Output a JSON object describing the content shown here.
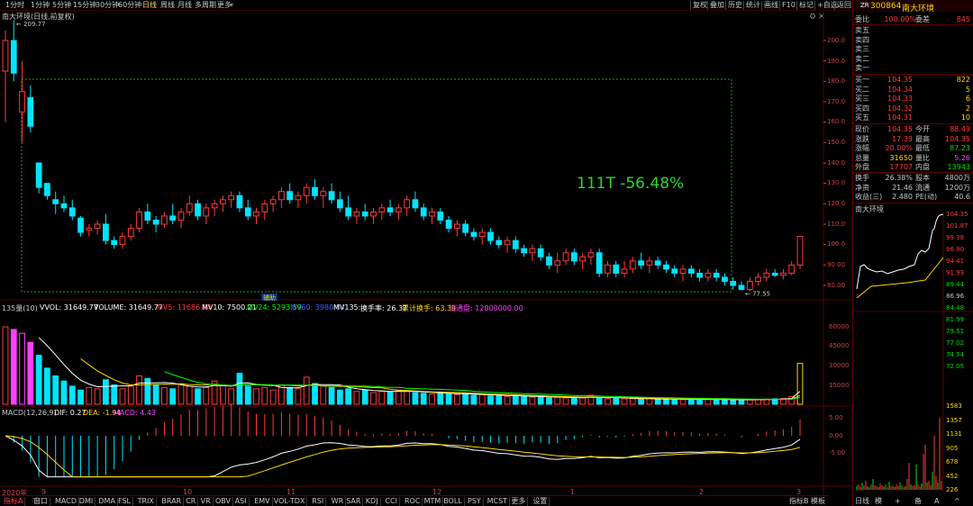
{
  "toolbar": {
    "periods": [
      "1分时",
      "1分钟",
      "5分钟",
      "15分钟",
      "30分钟",
      "60分钟",
      "日线",
      "周线",
      "月线",
      "多周期",
      "更多"
    ],
    "active_period": "日线",
    "tools": [
      "复权",
      "叠加",
      "历史",
      "统计",
      "画线",
      "F10",
      "标记",
      "+自选",
      "返回"
    ]
  },
  "chart": {
    "stock_label": "南大环境(日线,前复权)",
    "high_label": "209.77",
    "low_label": "77.55",
    "annotation": "111T -56.48%",
    "marker_label": "辅助",
    "candles": [
      [
        185,
        205,
        160,
        200
      ],
      [
        200,
        210,
        180,
        184
      ],
      [
        165,
        190,
        150,
        175
      ],
      [
        172,
        178,
        155,
        158
      ],
      [
        140,
        140,
        125,
        128
      ],
      [
        130,
        130,
        122,
        124
      ],
      [
        122,
        126,
        115,
        120
      ],
      [
        120,
        124,
        116,
        118
      ],
      [
        118,
        122,
        112,
        114
      ],
      [
        113,
        114,
        104,
        106
      ],
      [
        107,
        110,
        104,
        108
      ],
      [
        108,
        112,
        105,
        110
      ],
      [
        110,
        115,
        100,
        102
      ],
      [
        102,
        104,
        98,
        100
      ],
      [
        100,
        106,
        98,
        104
      ],
      [
        104,
        110,
        102,
        108
      ],
      [
        108,
        118,
        106,
        116
      ],
      [
        116,
        120,
        110,
        112
      ],
      [
        112,
        114,
        106,
        110
      ],
      [
        110,
        116,
        108,
        114
      ],
      [
        114,
        120,
        110,
        112
      ],
      [
        112,
        118,
        108,
        116
      ],
      [
        116,
        124,
        114,
        120
      ],
      [
        120,
        122,
        112,
        114
      ],
      [
        114,
        120,
        110,
        118
      ],
      [
        118,
        122,
        114,
        120
      ],
      [
        120,
        124,
        116,
        122
      ],
      [
        122,
        126,
        118,
        124
      ],
      [
        124,
        126,
        116,
        118
      ],
      [
        118,
        122,
        112,
        114
      ],
      [
        114,
        118,
        110,
        116
      ],
      [
        116,
        122,
        112,
        120
      ],
      [
        120,
        124,
        116,
        122
      ],
      [
        122,
        128,
        118,
        126
      ],
      [
        126,
        130,
        120,
        122
      ],
      [
        122,
        126,
        118,
        124
      ],
      [
        124,
        130,
        120,
        128
      ],
      [
        128,
        132,
        122,
        124
      ],
      [
        124,
        128,
        118,
        126
      ],
      [
        126,
        130,
        120,
        122
      ],
      [
        122,
        126,
        116,
        118
      ],
      [
        118,
        124,
        112,
        114
      ],
      [
        114,
        118,
        110,
        116
      ],
      [
        116,
        120,
        112,
        114
      ],
      [
        114,
        118,
        110,
        116
      ],
      [
        116,
        120,
        112,
        118
      ],
      [
        118,
        122,
        114,
        116
      ],
      [
        116,
        120,
        112,
        118
      ],
      [
        118,
        124,
        114,
        122
      ],
      [
        122,
        126,
        116,
        118
      ],
      [
        118,
        120,
        112,
        114
      ],
      [
        114,
        118,
        110,
        116
      ],
      [
        116,
        118,
        110,
        112
      ],
      [
        112,
        114,
        106,
        108
      ],
      [
        108,
        112,
        104,
        110
      ],
      [
        110,
        112,
        104,
        106
      ],
      [
        106,
        108,
        102,
        104
      ],
      [
        104,
        108,
        100,
        106
      ],
      [
        106,
        108,
        100,
        102
      ],
      [
        102,
        104,
        98,
        100
      ],
      [
        100,
        104,
        96,
        102
      ],
      [
        102,
        104,
        96,
        98
      ],
      [
        98,
        100,
        94,
        96
      ],
      [
        96,
        100,
        92,
        98
      ],
      [
        98,
        100,
        92,
        94
      ],
      [
        94,
        96,
        88,
        90
      ],
      [
        90,
        96,
        86,
        92
      ],
      [
        92,
        98,
        90,
        96
      ],
      [
        96,
        98,
        90,
        92
      ],
      [
        92,
        96,
        88,
        94
      ],
      [
        94,
        98,
        90,
        96
      ],
      [
        96,
        98,
        84,
        86
      ],
      [
        86,
        92,
        84,
        90
      ],
      [
        90,
        92,
        84,
        86
      ],
      [
        86,
        92,
        84,
        88
      ],
      [
        88,
        94,
        86,
        92
      ],
      [
        92,
        96,
        88,
        90
      ],
      [
        90,
        94,
        86,
        92
      ],
      [
        92,
        94,
        88,
        90
      ],
      [
        90,
        92,
        86,
        88
      ],
      [
        88,
        90,
        84,
        86
      ],
      [
        86,
        90,
        82,
        88
      ],
      [
        88,
        90,
        84,
        86
      ],
      [
        86,
        88,
        82,
        84
      ],
      [
        84,
        88,
        82,
        86
      ],
      [
        86,
        88,
        82,
        84
      ],
      [
        84,
        86,
        80,
        82
      ],
      [
        82,
        84,
        78,
        80
      ],
      [
        80,
        82,
        77.55,
        78
      ],
      [
        78,
        84,
        77,
        82
      ],
      [
        82,
        86,
        80,
        84
      ],
      [
        84,
        88,
        82,
        86
      ],
      [
        86,
        88,
        84,
        85
      ],
      [
        85,
        88,
        83,
        86
      ],
      [
        86,
        92,
        85,
        90
      ],
      [
        90,
        104.35,
        88,
        104
      ]
    ],
    "y_ticks": [
      "200.0",
      "190.0",
      "180.0",
      "170.0",
      "160.0",
      "150.0",
      "140.0",
      "130.0",
      "120.0",
      "110.0",
      "100.0",
      "90.00",
      "80.00"
    ],
    "x_labels": [
      "2020年",
      "9",
      "10",
      "11",
      "12",
      "1",
      "2",
      "3"
    ]
  },
  "volume": {
    "header": {
      "left": "135量(10)",
      "vvol": "VVOL: 31649.77",
      "volume": "VOLUME: 31649.77",
      "mv5": "MV5: 11686.84",
      "mv10": "MV10: 7500.21",
      "mv24": "MV24: 5293.59",
      "mv60": "MV60: 3980.84",
      "mv135": "MV135: -",
      "turn": "换手率: 26.37",
      "cum": "累计换手: 63.39",
      "flow": "流通盘: 12000000.00"
    },
    "y_ticks": [
      "60000",
      "45000",
      "30000",
      "15000"
    ],
    "bars": [
      60000,
      58000,
      55000,
      48000,
      38000,
      28000,
      22000,
      18000,
      14000,
      11000,
      13000,
      12000,
      19000,
      15000,
      12000,
      14000,
      22000,
      20000,
      15000,
      13000,
      12000,
      16000,
      14000,
      12000,
      13000,
      18000,
      15000,
      12000,
      24000,
      14000,
      12000,
      13000,
      11000,
      15000,
      13000,
      12000,
      21000,
      16000,
      14000,
      13000,
      11000,
      12000,
      10000,
      11000,
      9000,
      10000,
      9500,
      11000,
      10000,
      9000,
      8500,
      8000,
      9000,
      8000,
      7500,
      8000,
      7000,
      7500,
      6500,
      7000,
      6000,
      6500,
      6000,
      5500,
      6000,
      5000,
      5500,
      5000,
      4800,
      5000,
      7000,
      4600,
      4400,
      4800,
      4200,
      4400,
      4000,
      4200,
      3800,
      4000,
      3800,
      3600,
      4000,
      3500,
      3800,
      3400,
      3600,
      3200,
      3400,
      3600,
      3800,
      4000,
      4200,
      4500,
      6000,
      31649.77
    ]
  },
  "macd": {
    "header": {
      "title": "MACD(12,26,9)",
      "dif": "DIF: 0.27",
      "dea": "DEA: -1.94",
      "macd": "MACD: 4.43"
    },
    "y_ticks": [
      "5.00",
      "0.00",
      "-5.00"
    ]
  },
  "bottom_tabs": [
    "指标A",
    "窗口",
    "MACD",
    "DMI",
    "DMA",
    "FSL",
    "TRIX",
    "BRAR",
    "CR",
    "VR",
    "OBV",
    "ASI",
    "EMV",
    "VOL-TDX",
    "RSI",
    "WR",
    "SAR",
    "KDJ",
    "CCI",
    "ROC",
    "MTM",
    "BOLL",
    "PSY",
    "MCST",
    "更多",
    "设置"
  ],
  "bottom_right": [
    "指标B",
    "模板"
  ],
  "quote": {
    "code": "300864",
    "name": "南大环境",
    "ratio_label": "委比",
    "ratio": "100.00%",
    "diff_label": "委差",
    "diff": "845",
    "sells": [
      {
        "label": "卖五",
        "price": "",
        "vol": ""
      },
      {
        "label": "卖四",
        "price": "",
        "vol": ""
      },
      {
        "label": "卖三",
        "price": "",
        "vol": ""
      },
      {
        "label": "卖二",
        "price": "",
        "vol": ""
      },
      {
        "label": "卖一",
        "price": "",
        "vol": ""
      }
    ],
    "buys": [
      {
        "label": "买一",
        "price": "104.35",
        "vol": "822"
      },
      {
        "label": "买二",
        "price": "104.34",
        "vol": "5"
      },
      {
        "label": "买三",
        "price": "104.33",
        "vol": "6"
      },
      {
        "label": "买四",
        "price": "104.32",
        "vol": "2"
      },
      {
        "label": "买五",
        "price": "104.31",
        "vol": "10"
      }
    ],
    "stats": [
      {
        "l": "现价",
        "v": "104.35",
        "l2": "今开",
        "v2": "88.49"
      },
      {
        "l": "涨跌",
        "v": "17.39",
        "l2": "最高",
        "v2": "104.35"
      },
      {
        "l": "涨幅",
        "v": "20.00%",
        "l2": "最低",
        "v2": "87.23"
      },
      {
        "l": "总量",
        "v": "31650",
        "l2": "量比",
        "v2": "5.26"
      },
      {
        "l": "外盘",
        "v": "17707",
        "l2": "内盘",
        "v2": "13943"
      }
    ],
    "stats2": [
      {
        "l": "换手",
        "v": "26.38%",
        "l2": "股本",
        "v2": "4800万"
      },
      {
        "l": "净资",
        "v": "21.46",
        "l2": "流通",
        "v2": "1200万"
      },
      {
        "l": "收益(三)",
        "v": "2.480",
        "l2": "PE(动)",
        "v2": "40.6"
      }
    ],
    "mini_title": "南大环境",
    "mini_price_ticks": [
      "104.35",
      "101.87",
      "99.38",
      "96.90",
      "94.41",
      "91.93",
      "89.44",
      "86.96",
      "84.48",
      "81.99",
      "79.51",
      "77.02",
      "74.54",
      "72.05"
    ],
    "mini_vol_ticks": [
      "1583",
      "1357",
      "1131",
      "905",
      "678",
      "452",
      "226"
    ],
    "tabs": [
      "日线",
      "模",
      "+",
      "备",
      "A",
      "^"
    ]
  },
  "colors": {
    "up": "#ff3a3a",
    "down": "#00e4ff",
    "grid": "#5a0000",
    "ma5": "#ffffff",
    "ma10": "#ffd700",
    "ma20": "#ff40ff",
    "ma30": "#00ff00"
  }
}
